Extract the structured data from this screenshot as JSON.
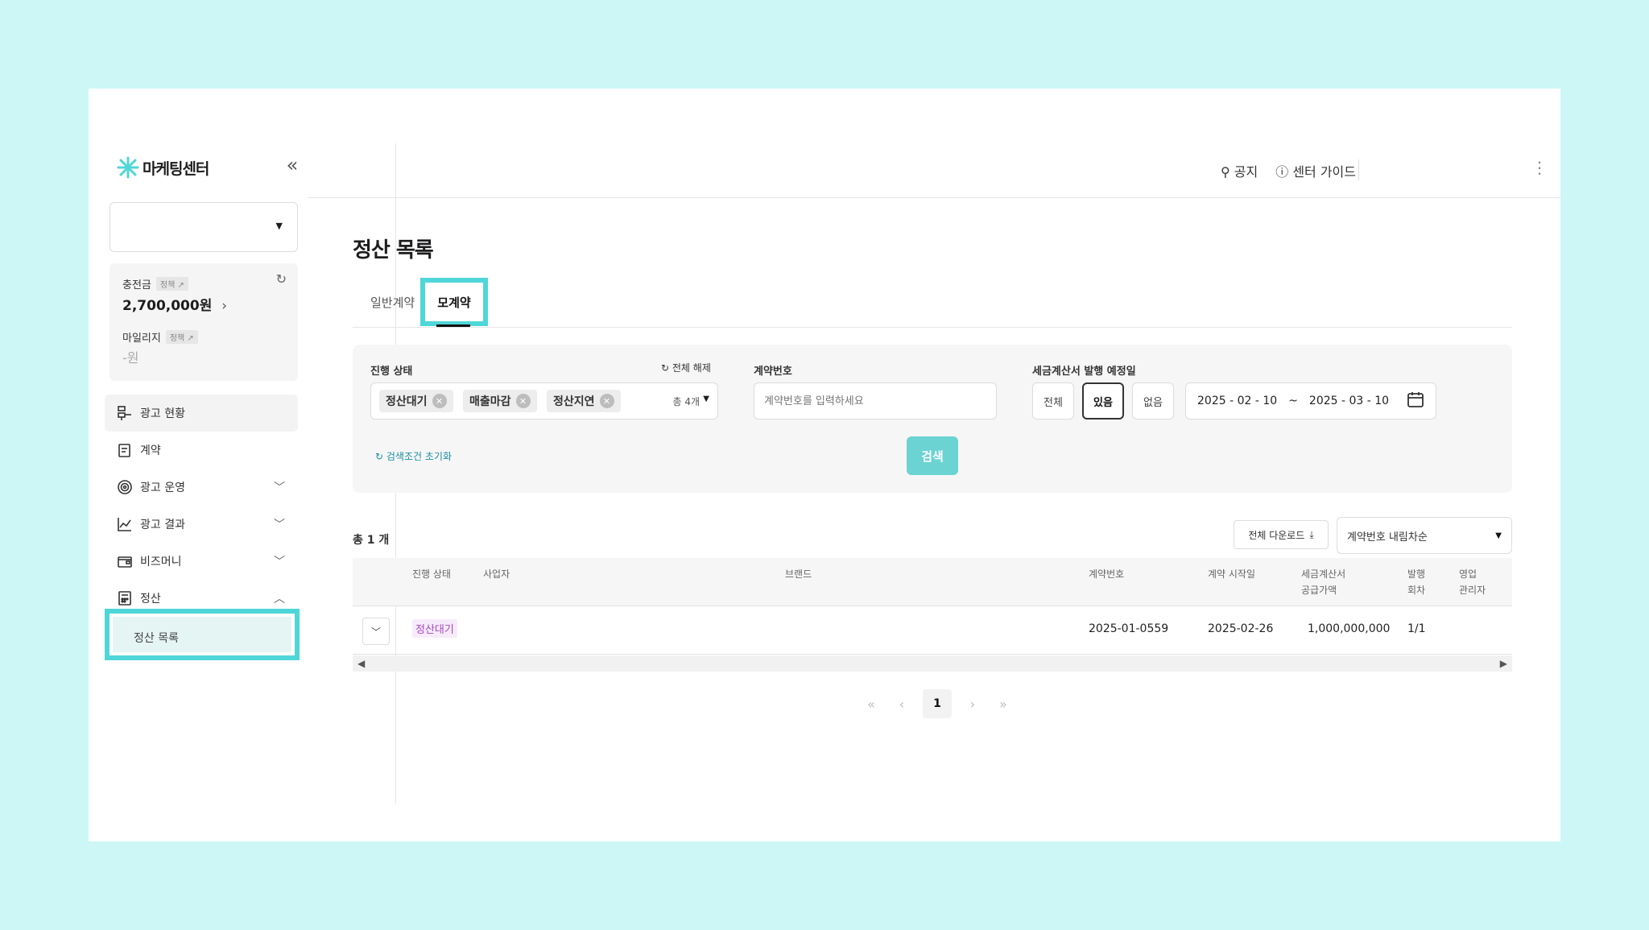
{
  "colors": {
    "accent": "#4fd6d8",
    "badge_bg": "#f7ebfb",
    "badge_text": "#a44ac0",
    "search_btn": "#6cd3d3"
  },
  "brand": {
    "name": "마케팅센터",
    "collapse": "«"
  },
  "wallet": {
    "charge_label": "충전금",
    "charge_tag": "정책 ↗",
    "charge_value": "2,700,000원",
    "mileage_label": "마일리지",
    "mileage_tag": "정책 ↗",
    "mileage_value": "-원"
  },
  "nav": {
    "items": [
      {
        "label": "광고 현황"
      },
      {
        "label": "계약"
      },
      {
        "label": "광고 운영"
      },
      {
        "label": "광고 결과"
      },
      {
        "label": "비즈머니"
      },
      {
        "label": "정산"
      }
    ],
    "sub_active": "정산 목록"
  },
  "topbar": {
    "notice": "공지",
    "guide": "센터 가이드"
  },
  "page": {
    "title": "정산 목록",
    "tabs": [
      "일반계약",
      "모계약"
    ]
  },
  "filter": {
    "status_label": "진행 상태",
    "clear_all": "전체 해제",
    "chips": [
      "정산대기",
      "매출마감",
      "정산지연"
    ],
    "chip_count": "총 4개",
    "contract_label": "계약번호",
    "contract_placeholder": "계약번호를 입력하세요",
    "invoice_label": "세금계산서 발행 예정일",
    "seg": [
      "전체",
      "있음",
      "없음"
    ],
    "date_from": "2025 - 02 - 10",
    "date_sep": "~",
    "date_to": "2025 - 03 - 10",
    "reset": "검색조건 초기화",
    "search": "검색"
  },
  "list": {
    "total": "총 1 개",
    "download": "전체 다운로드",
    "sort": "계약번호 내림차순",
    "headers": {
      "status": "진행 상태",
      "business": "사업자",
      "brand": "브랜드",
      "contract_no": "계약번호",
      "start": "계약 시작일",
      "amount_1": "세금계산서",
      "amount_2": "공급가액",
      "issue_1": "발행",
      "issue_2": "회차",
      "sales_1": "영업",
      "sales_2": "관리자"
    },
    "rows": [
      {
        "status": "정산대기",
        "contract_no": "2025-01-0559",
        "start": "2025-02-26",
        "amount": "1,000,000,000",
        "issue": "1/1"
      }
    ]
  },
  "pagination": {
    "first": "«",
    "prev": "‹",
    "current": "1",
    "next": "›",
    "last": "»"
  }
}
